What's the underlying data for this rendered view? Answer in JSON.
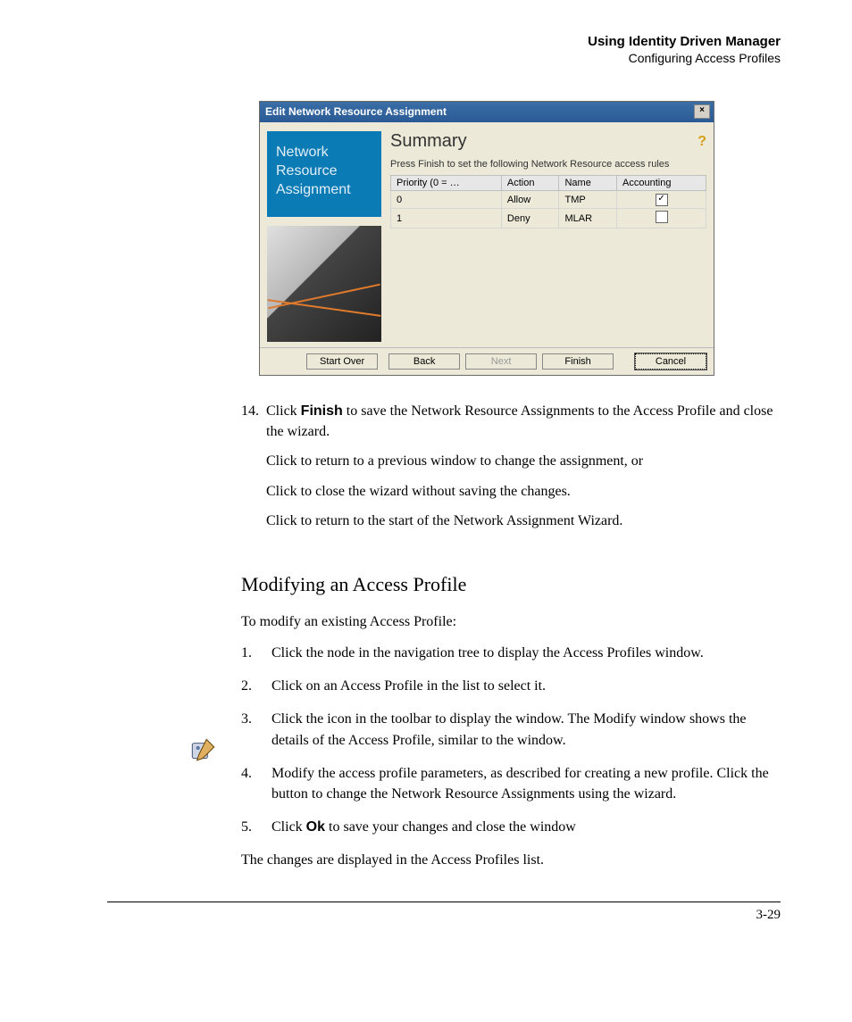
{
  "header": {
    "line1": "Using Identity Driven Manager",
    "line2": "Configuring Access Profiles"
  },
  "dialog": {
    "title": "Edit Network Resource Assignment",
    "close_glyph": "×",
    "sidebar_label_l1": "Network",
    "sidebar_label_l2": "Resource",
    "sidebar_label_l3": "Assignment",
    "summary_heading": "Summary",
    "help_glyph": "?",
    "instruction": "Press Finish to set the following Network Resource access rules",
    "columns": {
      "priority": "Priority (0 = …",
      "action": "Action",
      "name": "Name",
      "accounting": "Accounting"
    },
    "rows": [
      {
        "priority": "0",
        "action": "Allow",
        "name": "TMP",
        "accounting_checked": "✓"
      },
      {
        "priority": "1",
        "action": "Deny",
        "name": "MLAR",
        "accounting_checked": ""
      }
    ],
    "buttons": {
      "start_over": "Start Over",
      "back": "Back",
      "next": "Next",
      "finish": "Finish",
      "cancel": "Cancel"
    }
  },
  "step14": {
    "number": "14.",
    "text_a": "Click ",
    "bold_finish": "Finish",
    "text_b": " to save the Network Resource Assignments to the Access Profile and close the wizard.",
    "sub1": "Click          to return to a previous window to change the assignment, or",
    "sub2": "Click             to close the wizard without saving the changes.",
    "sub3": "Click                   to return to the start of the Network Assignment Wizard."
  },
  "section_heading": "Modifying an Access Profile",
  "modify_intro": "To modify an existing Access Profile:",
  "steps": [
    {
      "n": "1.",
      "text": "Click the                          node in the                                                   navigation tree to display the Access Profiles window."
    },
    {
      "n": "2.",
      "text": "Click on an Access Profile in the list to select it."
    },
    {
      "n": "3.",
      "text": "Click the                                     icon in the toolbar to display the                                           window. The Modify window shows the details of the Access Profile, similar to the                                              window."
    },
    {
      "n": "4.",
      "text": "Modify the access profile parameters, as described for creating a new profile. Click the           button to change the Network Resource Assignments using the wizard."
    },
    {
      "n": "5.",
      "text_a": "Click ",
      "bold": "Ok",
      "text_b": " to save your changes and close the window"
    }
  ],
  "closing": "The changes are displayed in the Access Profiles list.",
  "page_number": "3-29"
}
